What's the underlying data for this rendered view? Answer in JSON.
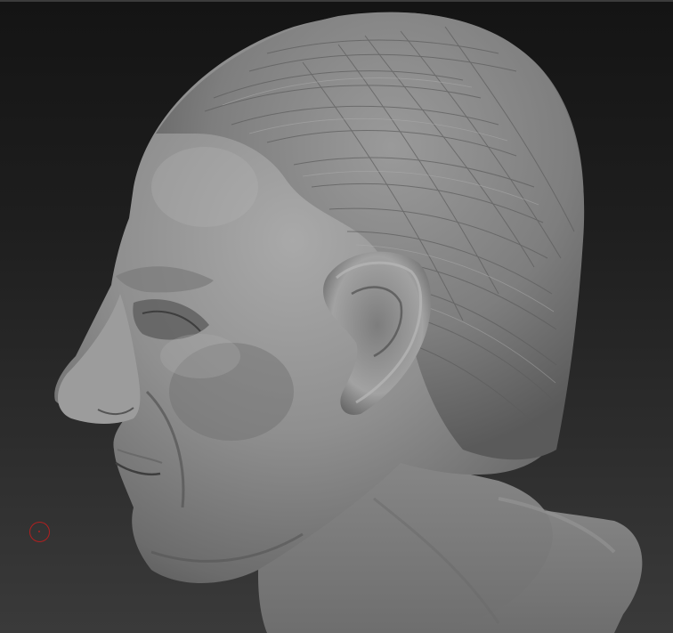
{
  "viewport": {
    "background_top": "#141414",
    "background_bottom": "#3a3a3a",
    "model": "sculpted-male-head-bust",
    "material_color": "#8a8a8a"
  },
  "cursor": {
    "type": "brush-cursor",
    "color": "#b02020"
  }
}
